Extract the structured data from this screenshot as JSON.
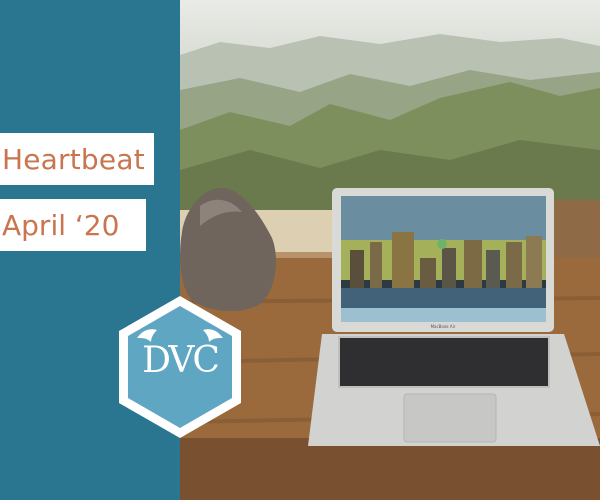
{
  "title_lines": [
    "Heartbeat",
    "April ‘20"
  ],
  "logo": {
    "text": "DVC",
    "hex_fill": "#5fa6c3",
    "hex_border": "#ffffff"
  },
  "colors": {
    "panel": "#2a7690",
    "label_text": "#c87550",
    "label_bg": "#ffffff"
  },
  "laptop": {
    "brand": "MacBook Air"
  }
}
